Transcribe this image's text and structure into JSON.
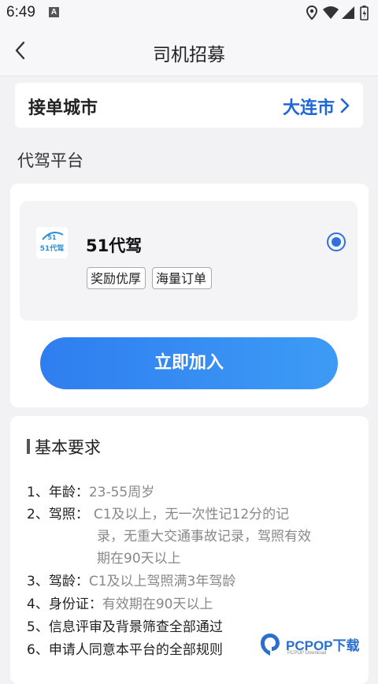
{
  "status": {
    "time": "6:49",
    "app_icon_letter": "A"
  },
  "nav": {
    "title": "司机招募"
  },
  "city": {
    "label": "接单城市",
    "value": "大连市"
  },
  "section": {
    "title": "代驾平台"
  },
  "platform": {
    "name": "51代驾",
    "logo_text": "51代驾",
    "tags": [
      "奖励优厚",
      "海量订单"
    ],
    "selected": true,
    "join_label": "立即加入"
  },
  "requirements": {
    "title": "基本要求",
    "items": [
      {
        "label": "1、年龄：",
        "value": "23-55周岁"
      },
      {
        "label": "2、驾照：",
        "value": "C1及以上，无一次性记12分的记",
        "value_cont": [
          "录，无重大交通事故记录，驾照有效",
          "期在90天以上"
        ]
      },
      {
        "label": "3、驾龄：",
        "value": "C1及以上驾照满3年驾龄"
      },
      {
        "label": "4、身份证：",
        "value": "有效期在90天以上"
      },
      {
        "label": "5、信息评审及背景筛查全部通过",
        "value": ""
      },
      {
        "label": "6、申请人同意本平台的全部规则",
        "value": ""
      }
    ]
  },
  "watermark": {
    "text": "PCPOP下载",
    "sub": "PCPOP Download"
  },
  "colors": {
    "accent": "#1f66d6",
    "button": "#2f7ef0",
    "background": "#f2f2f4"
  }
}
